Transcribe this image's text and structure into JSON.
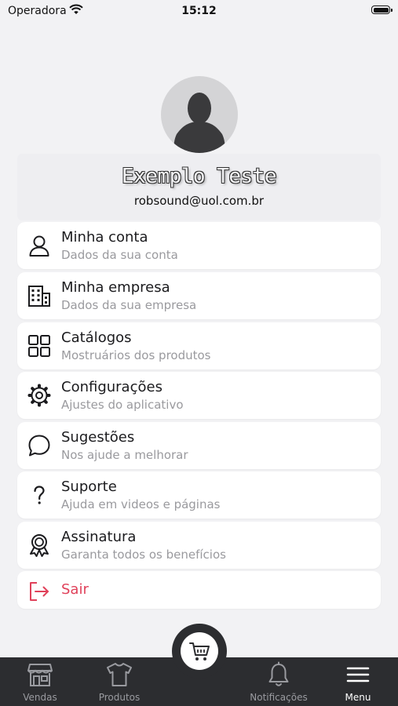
{
  "status_bar": {
    "carrier": "Operadora",
    "time": "15:12"
  },
  "profile": {
    "name": "Exemplo Teste",
    "email": "robsound@uol.com.br"
  },
  "menu": {
    "items": [
      {
        "title": "Minha conta",
        "subtitle": "Dados da sua conta",
        "icon": "user-icon"
      },
      {
        "title": "Minha empresa",
        "subtitle": "Dados da sua empresa",
        "icon": "building-icon"
      },
      {
        "title": "Catálogos",
        "subtitle": "Mostruários dos produtos",
        "icon": "grid-icon"
      },
      {
        "title": "Configurações",
        "subtitle": "Ajustes do aplicativo",
        "icon": "gear-icon"
      },
      {
        "title": "Sugestões",
        "subtitle": "Nos ajude a melhorar",
        "icon": "chat-bubble-icon"
      },
      {
        "title": "Suporte",
        "subtitle": "Ajuda em videos e páginas",
        "icon": "question-icon"
      },
      {
        "title": "Assinatura",
        "subtitle": "Garanta todos os benefícios",
        "icon": "award-ribbon-icon"
      }
    ],
    "logout": {
      "title": "Sair",
      "icon": "logout-icon",
      "color": "#e0415a"
    }
  },
  "tab_bar": {
    "tabs": [
      {
        "label": "Vendas",
        "icon": "store-icon"
      },
      {
        "label": "Produtos",
        "icon": "tshirt-icon"
      },
      {
        "label": "Notificações",
        "icon": "bell-icon"
      },
      {
        "label": "Menu",
        "icon": "hamburger-icon"
      }
    ],
    "active": "Menu",
    "center_button_icon": "cart-icon"
  },
  "colors": {
    "background": "#f2f2f4",
    "tab_bar": "#2c2d30",
    "danger": "#e0415a",
    "subtitle": "#9a9a9e"
  }
}
